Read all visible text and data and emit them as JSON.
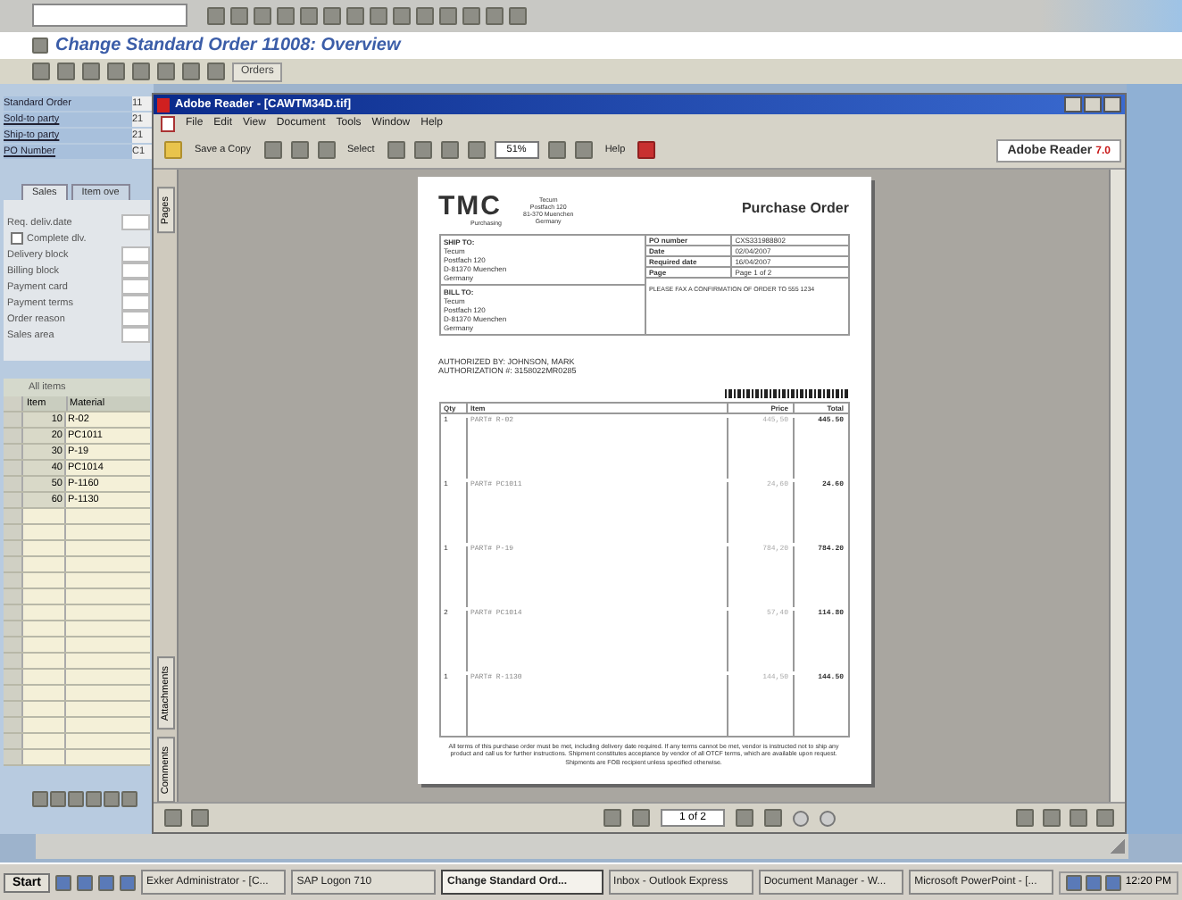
{
  "sap": {
    "title": "Change Standard Order 11008: Overview",
    "toolbar_button": "Orders",
    "header_fields": [
      {
        "label": "Standard Order",
        "value": "11",
        "kind": "text"
      },
      {
        "label": "Sold-to party",
        "value": "21",
        "kind": "link"
      },
      {
        "label": "Ship-to party",
        "value": "21",
        "kind": "link"
      },
      {
        "label": "PO Number",
        "value": "C1",
        "kind": "link"
      }
    ],
    "tabs": [
      {
        "label": "Sales",
        "selected": true
      },
      {
        "label": "Item ove",
        "selected": false
      }
    ],
    "fields": [
      {
        "label": "Req. deliv.date",
        "kind": "field"
      },
      {
        "label": "Complete dlv.",
        "kind": "checkbox",
        "checked": false
      },
      {
        "label": "Delivery block",
        "kind": "field"
      },
      {
        "label": "Billing block",
        "kind": "field"
      },
      {
        "label": "Payment card",
        "kind": "field"
      },
      {
        "label": "Payment terms",
        "kind": "field"
      },
      {
        "label": "Order reason",
        "kind": "field"
      },
      {
        "label": "Sales area",
        "kind": "field"
      }
    ],
    "items_table": {
      "title": "All items",
      "columns": [
        "Item",
        "Material"
      ],
      "rows": [
        [
          "10",
          "R-02"
        ],
        [
          "20",
          "PC1011"
        ],
        [
          "30",
          "P-19"
        ],
        [
          "40",
          "PC1014"
        ],
        [
          "50",
          "P-1160"
        ],
        [
          "60",
          "P-1130"
        ]
      ]
    }
  },
  "reader": {
    "title": "Adobe Reader - [CAWTM34D.tif]",
    "menu": [
      "File",
      "Edit",
      "View",
      "Document",
      "Tools",
      "Window",
      "Help"
    ],
    "toolbar": {
      "save": "Save a Copy",
      "select": "Select",
      "zoom": "51%",
      "help": "Help",
      "brand": "Adobe Reader",
      "version": "7.0"
    },
    "side_tabs": [
      "Pages",
      "Attachments",
      "Comments"
    ],
    "page_nav": "1 of 2",
    "document": {
      "logo": "TMC",
      "logo_sub": "Purchasing",
      "company": [
        "Tecum",
        "Postfach 120",
        "81-370 Muenchen",
        "Germany"
      ],
      "title": "Purchase Order",
      "ship_to": {
        "heading": "SHIP TO:",
        "lines": [
          "Tecum",
          "Postfach 120",
          "D-81370 Muenchen",
          "Germany"
        ]
      },
      "bill_to": {
        "heading": "BILL TO:",
        "lines": [
          "Tecum",
          "Postfach 120",
          "D-81370 Muenchen",
          "Germany"
        ]
      },
      "info": [
        {
          "label": "PO number",
          "value": "CXS331988802"
        },
        {
          "label": "Date",
          "value": "02/04/2007"
        },
        {
          "label": "Required date",
          "value": "16/04/2007"
        },
        {
          "label": "Page",
          "value": "Page 1 of 2"
        }
      ],
      "note": "PLEASE FAX A CONFIRMATION OF ORDER TO 555 1234",
      "authorized": "AUTHORIZED BY: JOHNSON, MARK",
      "authorization": "AUTHORIZATION #: 3158022MR0285",
      "columns": [
        "Qty",
        "Item",
        "Price",
        "Total"
      ],
      "items": [
        {
          "qty": "1",
          "item": "PART# R-02",
          "price": "445,50",
          "total": "445.50"
        },
        {
          "qty": "1",
          "item": "PART# PC1011",
          "price": "24,60",
          "total": "24.60"
        },
        {
          "qty": "1",
          "item": "PART# P-19",
          "price": "784,20",
          "total": "784.20"
        },
        {
          "qty": "2",
          "item": "PART# PC1014",
          "price": "57,40",
          "total": "114.80"
        },
        {
          "qty": "1",
          "item": "PART# R-1130",
          "price": "144,50",
          "total": "144.50"
        }
      ],
      "footer": "All terms of this purchase order must be met, including delivery date required. If any terms cannot be met, vendor is instructed not to ship any product and call us for further instructions. Shipment constitutes acceptance by vendor of all OTCF terms, which are available upon request. Shipments are FOB recipient unless specified otherwise."
    }
  },
  "taskbar": {
    "start": "Start",
    "tasks": [
      {
        "label": "Exker Administrator - [C...",
        "selected": false
      },
      {
        "label": "SAP Logon 710",
        "selected": false
      },
      {
        "label": "Change Standard Ord...",
        "selected": true
      },
      {
        "label": "Inbox - Outlook Express",
        "selected": false
      },
      {
        "label": "Document Manager - W...",
        "selected": false
      },
      {
        "label": "Microsoft PowerPoint - [...",
        "selected": false
      }
    ],
    "clock": "12:20 PM"
  }
}
